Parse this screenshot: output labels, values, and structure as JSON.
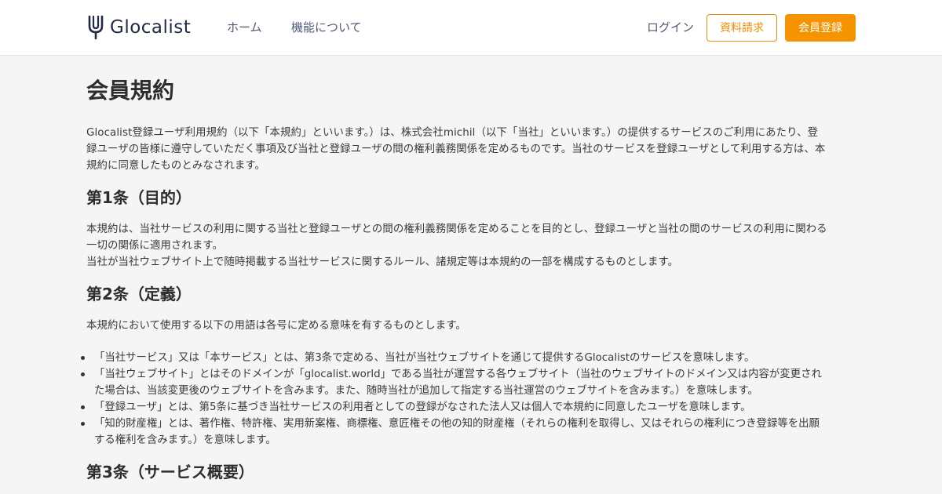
{
  "header": {
    "logo_text": "Glocalist",
    "nav": {
      "home": "ホーム",
      "features": "機能について",
      "login": "ログイン"
    },
    "buttons": {
      "request_docs": "資料請求",
      "register": "会員登録"
    },
    "colors": {
      "accent": "#f59300",
      "nav_text": "#4f5a75"
    }
  },
  "main": {
    "title": "会員規約",
    "intro": [
      "Glocalist登録ユーザ利用規約（以下「本規約」といいます。）は、株式会社michil（以下「当社」といいます。）の提供するサービスのご利用にあたり、登",
      "録ユーザの皆様に遵守していただく事項及び当社と登録ユーザの間の権利義務関係を定めるものです。当社のサービスを登録ユーザとして利用する方は、本",
      "規約に同意したものとみなされます。"
    ],
    "article1": {
      "title": "第1条（目的）",
      "lines": [
        "本規約は、当社サービスの利用に関する当社と登録ユーザとの間の権利義務関係を定めることを目的とし、登録ユーザと当社の間のサービスの利用に関わる",
        "一切の関係に適用されます。",
        "当社が当社ウェブサイト上で随時掲載する当社サービスに関するルール、諸規定等は本規約の一部を構成するものとします。"
      ]
    },
    "article2": {
      "title": "第2条（定義）",
      "intro": "本規約において使用する以下の用語は各号に定める意味を有するものとします。",
      "items": [
        [
          "「当社サービス」又は「本サービス」とは、第3条で定める、当社が当社ウェブサイトを通じて提供するGlocalistのサービスを意味します。"
        ],
        [
          "「当社ウェブサイト」とはそのドメインが「glocalist.world」である当社が運営する各ウェブサイト（当社のウェブサイトのドメイン又は内容が変更され",
          "た場合は、当該変更後のウェブサイトを含みます。また、随時当社が追加して指定する当社運営のウェブサイトを含みます。）を意味します。"
        ],
        [
          "「登録ユーザ」とは、第5条に基づき当社サービスの利用者としての登録がなされた法人又は個人で本規約に同意したユーザを意味します。"
        ],
        [
          "「知的財産権」とは、著作権、特許権、実用新案権、商標権、意匠権その他の知的財産権（それらの権利を取得し、又はそれらの権利につき登録等を出願",
          "する権利を含みます。）を意味します。"
        ]
      ]
    },
    "article3": {
      "title": "第3条（サービス概要）"
    }
  }
}
